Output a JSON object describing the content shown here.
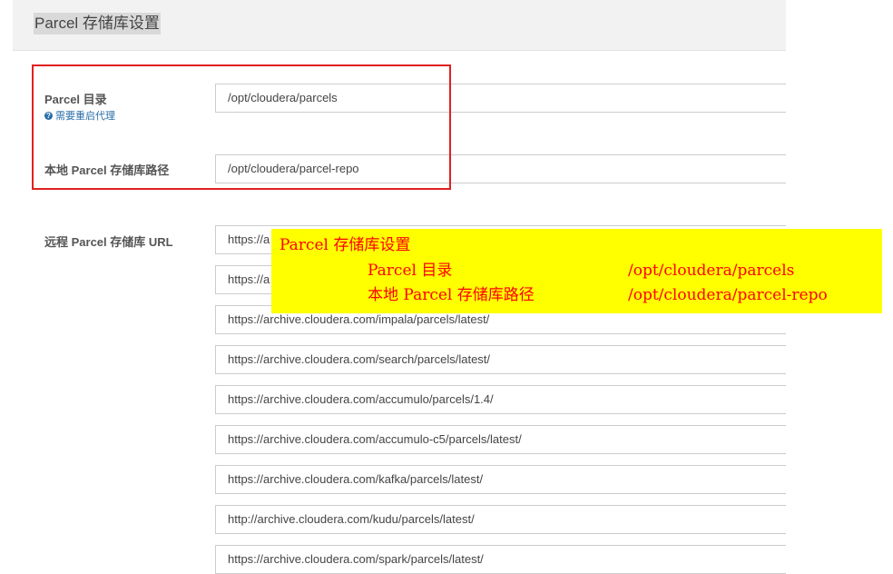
{
  "header": {
    "title": "Parcel 存储库设置"
  },
  "parcel_dir": {
    "label": "Parcel 目录",
    "hint": "需要重启代理",
    "value": "/opt/cloudera/parcels"
  },
  "local_repo": {
    "label": "本地 Parcel 存储库路径",
    "value": "/opt/cloudera/parcel-repo"
  },
  "remote_repo": {
    "label": "远程 Parcel 存储库 URL",
    "urls": [
      "https://a",
      "https://a",
      "https://archive.cloudera.com/impala/parcels/latest/",
      "https://archive.cloudera.com/search/parcels/latest/",
      "https://archive.cloudera.com/accumulo/parcels/1.4/",
      "https://archive.cloudera.com/accumulo-c5/parcels/latest/",
      "https://archive.cloudera.com/kafka/parcels/latest/",
      "http://archive.cloudera.com/kudu/parcels/latest/",
      "https://archive.cloudera.com/spark/parcels/latest/"
    ]
  },
  "annotation": {
    "title": "Parcel 存储库设置",
    "row1_label": "Parcel 目录",
    "row1_value": "/opt/cloudera/parcels",
    "row2_label": "本地 Parcel 存储库路径",
    "row2_value": "/opt/cloudera/parcel-repo"
  },
  "colors": {
    "highlight_box": "#e02020",
    "annotation_bg": "#ffff00",
    "annotation_text": "#ff0000",
    "hint_text": "#2a6ea8"
  }
}
